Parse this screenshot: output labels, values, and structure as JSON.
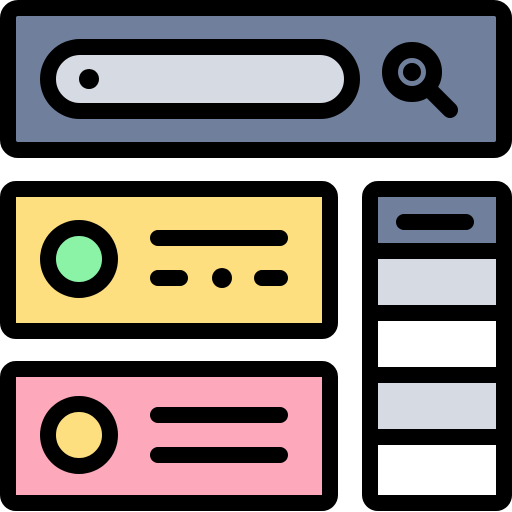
{
  "icon": {
    "name": "web-layout-search-icon",
    "colors": {
      "outline": "#000000",
      "search_bar_bg": "#6f7f9c",
      "search_field": "#d6dae2",
      "card_yellow": "#fddf7f",
      "card_pink": "#fea8bb",
      "avatar_green": "#8af3a6",
      "avatar_yellow": "#fddf7f",
      "sidebar_header": "#6f7f9c",
      "sidebar_row_gray": "#d6dae2",
      "sidebar_row_white": "#ffffff"
    },
    "parts": {
      "search_bar": "search-bar",
      "search_icon": "magnifier-icon",
      "card_1": "profile-card-yellow",
      "card_2": "profile-card-pink",
      "sidebar": "sidebar-list"
    }
  }
}
